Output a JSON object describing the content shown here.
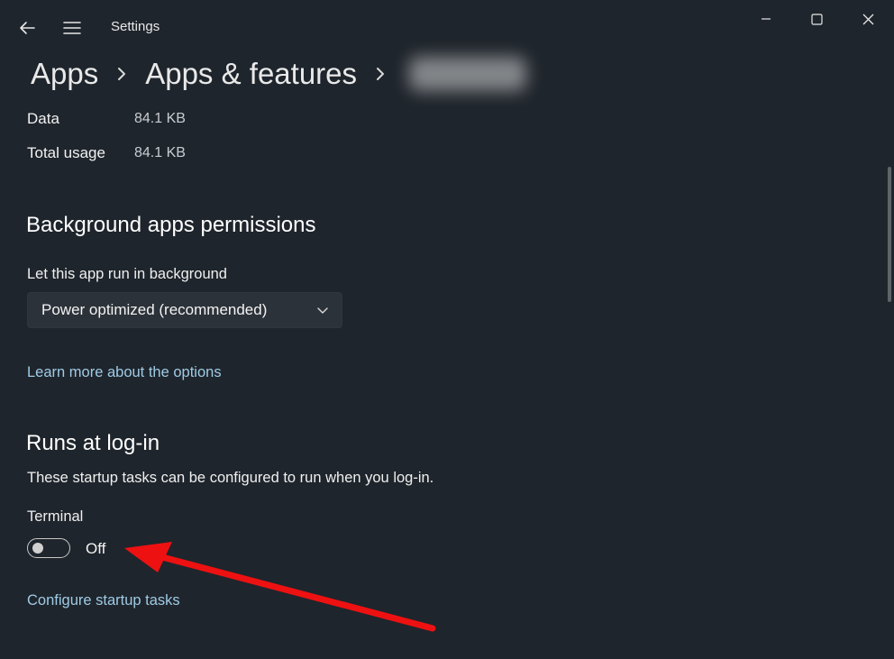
{
  "window": {
    "title": "Settings"
  },
  "breadcrumb": {
    "items": [
      "Apps",
      "Apps & features"
    ],
    "current_obscured": true
  },
  "storage": {
    "rows": [
      {
        "label": "Data",
        "value": "84.1 KB"
      },
      {
        "label": "Total usage",
        "value": "84.1 KB"
      }
    ]
  },
  "background_permissions": {
    "title": "Background apps permissions",
    "label": "Let this app run in background",
    "dropdown_value": "Power optimized (recommended)",
    "learn_more_link": "Learn more about the options"
  },
  "runs_at_login": {
    "title": "Runs at log-in",
    "description": "These startup tasks can be configured to run when you log-in.",
    "task_name": "Terminal",
    "toggle_state": "Off",
    "toggle_on": false,
    "configure_link": "Configure startup tasks"
  },
  "icons": {
    "back": "back-arrow-icon",
    "menu": "hamburger-menu-icon",
    "minimize": "minimize-icon",
    "maximize": "maximize-icon",
    "close": "close-icon",
    "dropdown": "chevron-down-icon",
    "breadcrumb_separator": "chevron-right-icon"
  },
  "colors": {
    "background": "#1f252c",
    "link": "#9ecbe6",
    "annotation_arrow": "#ee1111"
  }
}
